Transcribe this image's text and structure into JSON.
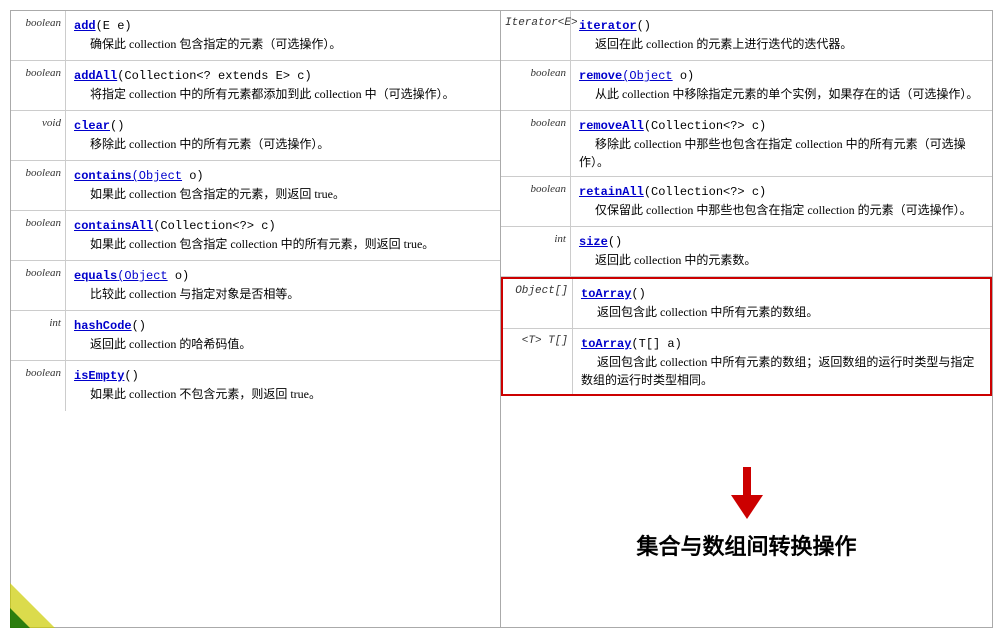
{
  "left_panel": {
    "methods": [
      {
        "return_type": "boolean",
        "signature": "add(E e)",
        "description": "确保此 collection 包含指定的元素（可选操作）。"
      },
      {
        "return_type": "boolean",
        "signature": "addAll(Collection<? extends E> c)",
        "description": "将指定 collection 中的所有元素都添加到此 collection 中（可选操作）。"
      },
      {
        "return_type": "void",
        "signature": "clear()",
        "description": "移除此 collection 中的所有元素（可选操作）。"
      },
      {
        "return_type": "boolean",
        "signature": "contains(Object o)",
        "description": "如果此 collection 包含指定的元素，则返回 true。"
      },
      {
        "return_type": "boolean",
        "signature": "containsAll(Collection<?> c)",
        "description": "如果此 collection 包含指定 collection 中的所有元素，则返回 true。"
      },
      {
        "return_type": "boolean",
        "signature": "equals(Object o)",
        "description": "比较此 collection 与指定对象是否相等。"
      },
      {
        "return_type": "int",
        "signature": "hashCode()",
        "description": "返回此 collection 的哈希码值。"
      },
      {
        "return_type": "boolean",
        "signature": "isEmpty()",
        "description": "如果此 collection 不包含元素，则返回 true。"
      }
    ]
  },
  "right_panel": {
    "methods": [
      {
        "return_type": "Iterator<E>",
        "signature": "iterator()",
        "description": "返回在此 collection 的元素上进行迭代的迭代器。"
      },
      {
        "return_type": "boolean",
        "signature": "remove(Object o)",
        "description": "从此 collection 中移除指定元素的单个实例，如果存在的话（可选操作）。"
      },
      {
        "return_type": "boolean",
        "signature": "removeAll(Collection<?> c)",
        "description": "移除此 collection 中那些也包含在指定 collection 中的所有元素（可选操作）。"
      },
      {
        "return_type": "boolean",
        "signature": "retainAll(Collection<?> c)",
        "description": "仅保留此 collection 中那些也包含在指定 collection 的元素（可选操作）。"
      },
      {
        "return_type": "int",
        "signature": "size()",
        "description": "返回此 collection 中的元素数。"
      },
      {
        "return_type": "Object[]",
        "signature": "toArray()",
        "description": "返回包含此 collection 中所有元素的数组。",
        "highlighted": true
      },
      {
        "return_type": "<T> T[]",
        "signature": "toArray(T[] a)",
        "description": "返回包含此 collection 中所有元素的数组；返回数组的运行时类型与指定数组的运行时类型相同。",
        "highlighted": true
      }
    ],
    "arrow_label": "集合与数组间转换操作"
  }
}
